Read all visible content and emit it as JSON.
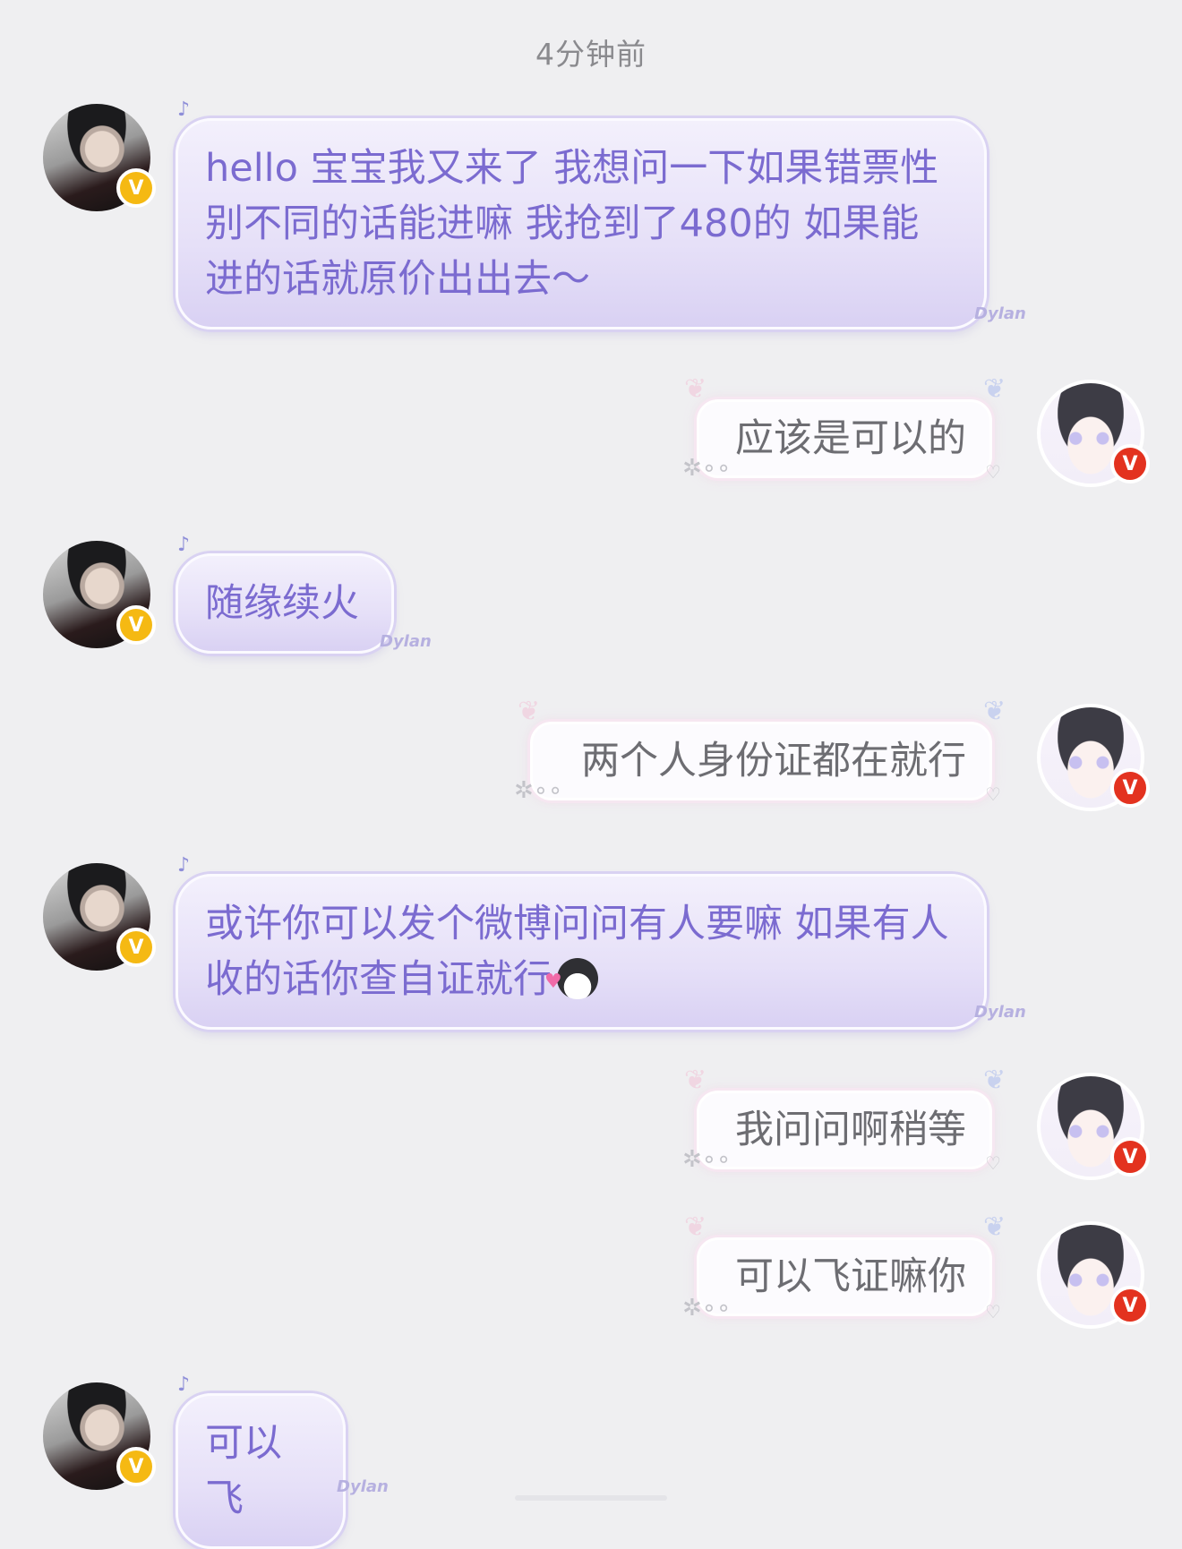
{
  "timestamp": "4分钟前",
  "messages": [
    {
      "side": "left",
      "text": "hello 宝宝我又来了 我想问一下如果错票性别不同的话能进嘛 我抢到了480的 如果能进的话就原价出出去～"
    },
    {
      "side": "right",
      "text": "应该是可以的"
    },
    {
      "side": "left",
      "text": "随缘续火"
    },
    {
      "side": "right",
      "text": "两个人身份证都在就行"
    },
    {
      "side": "left",
      "text": "或许你可以发个微博问问有人要嘛 如果有人收的话你查自证就行"
    },
    {
      "side": "right",
      "text": "我问问啊稍等"
    },
    {
      "side": "right",
      "text": "可以飞证嘛你"
    },
    {
      "side": "left",
      "text": "可以飞"
    }
  ],
  "decorations": {
    "bubble_tag": "Dylan",
    "verified_badge": "V",
    "emoji": "cat-heart-emoji"
  },
  "colors": {
    "background": "#efeff1",
    "left_bubble_text": "#7b6bd0",
    "right_bubble_text": "#6d6d72",
    "verified_gold": "#f5b913",
    "verified_red": "#e3321f"
  }
}
